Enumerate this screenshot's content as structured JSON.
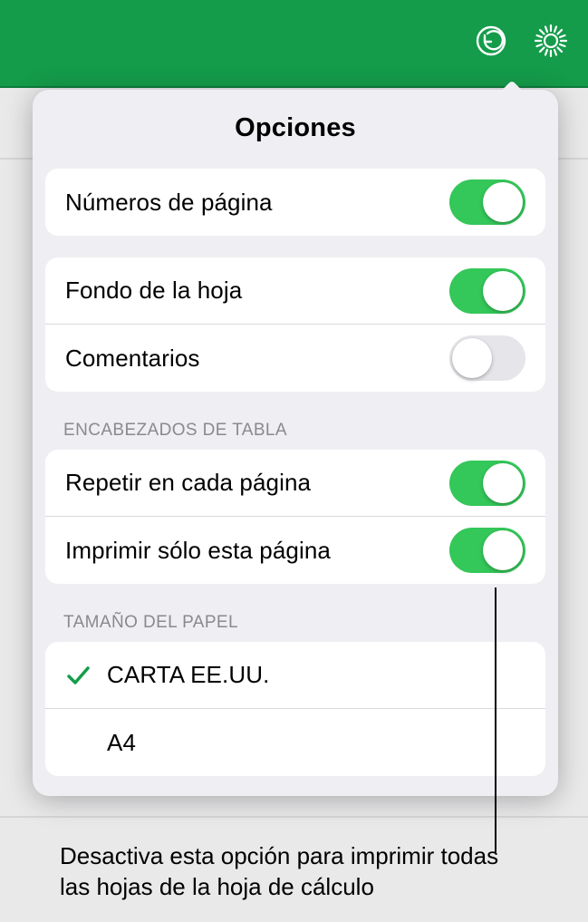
{
  "brand_color": "#149c4a",
  "toggle_on_color": "#34c759",
  "topbar": {
    "undo_icon": "undo-icon",
    "settings_icon": "gear-icon"
  },
  "popover": {
    "title": "Opciones",
    "group1": [
      {
        "label": "Números de página",
        "on": true
      }
    ],
    "group2": [
      {
        "label": "Fondo de la hoja",
        "on": true
      },
      {
        "label": "Comentarios",
        "on": false
      }
    ],
    "section_headers": {
      "headers": "ENCABEZADOS DE TABLA",
      "paper": "TAMAÑO DEL PAPEL"
    },
    "group3": [
      {
        "label": "Repetir en cada página",
        "on": true
      },
      {
        "label": "Imprimir sólo esta página",
        "on": true
      }
    ],
    "paper_sizes": [
      {
        "label": "CARTA EE.UU.",
        "selected": true
      },
      {
        "label": "A4",
        "selected": false
      }
    ]
  },
  "callout": {
    "text": "Desactiva esta opción para imprimir todas las hojas de la hoja de cálculo"
  }
}
